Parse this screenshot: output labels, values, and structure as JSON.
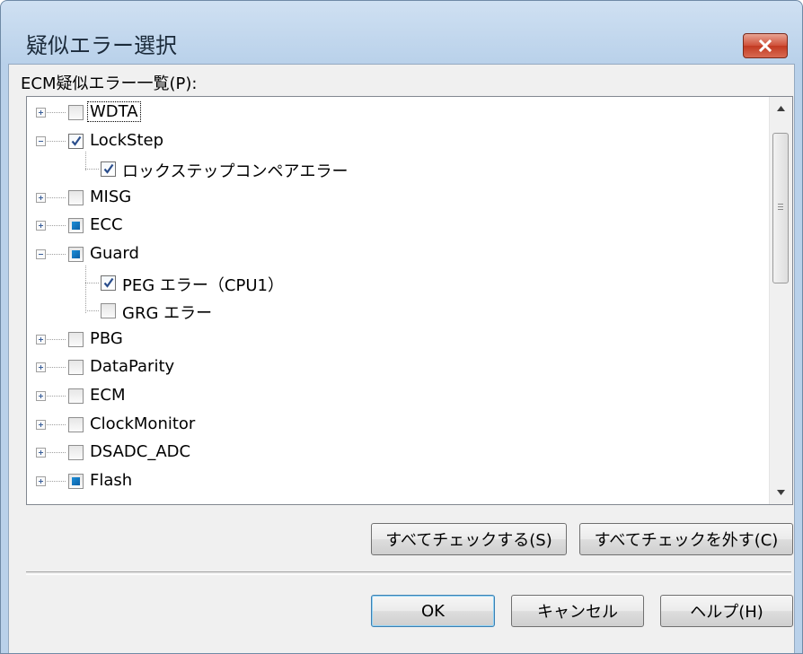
{
  "window": {
    "title": "疑似エラー選択"
  },
  "list": {
    "label": "ECM疑似エラー一覧(P):"
  },
  "tree": {
    "nodes": [
      {
        "label": "WDTA",
        "state": "unchecked",
        "expander": "plus",
        "level": 0,
        "focused": true
      },
      {
        "label": "LockStep",
        "state": "checked",
        "expander": "minus",
        "level": 0
      },
      {
        "label": "ロックステップコンペアエラー",
        "state": "checked",
        "expander": "none",
        "level": 1
      },
      {
        "label": "MISG",
        "state": "unchecked",
        "expander": "plus",
        "level": 0
      },
      {
        "label": "ECC",
        "state": "partial",
        "expander": "plus",
        "level": 0
      },
      {
        "label": "Guard",
        "state": "partial",
        "expander": "minus",
        "level": 0
      },
      {
        "label": "PEG エラー（CPU1）",
        "state": "checked",
        "expander": "none",
        "level": 1
      },
      {
        "label": "GRG エラー",
        "state": "unchecked",
        "expander": "none",
        "level": 1
      },
      {
        "label": "PBG",
        "state": "unchecked",
        "expander": "plus",
        "level": 0
      },
      {
        "label": "DataParity",
        "state": "unchecked",
        "expander": "plus",
        "level": 0
      },
      {
        "label": "ECM",
        "state": "unchecked",
        "expander": "plus",
        "level": 0
      },
      {
        "label": "ClockMonitor",
        "state": "unchecked",
        "expander": "plus",
        "level": 0
      },
      {
        "label": "DSADC_ADC",
        "state": "unchecked",
        "expander": "plus",
        "level": 0
      },
      {
        "label": "Flash",
        "state": "partial",
        "expander": "plus",
        "level": 0
      }
    ]
  },
  "buttons": {
    "check_all": "すべてチェックする(S)",
    "uncheck_all": "すべてチェックを外す(C)",
    "ok": "OK",
    "cancel": "キャンセル",
    "help": "ヘルプ(H)"
  },
  "colors": {
    "title_gradient_top": "#cfe0f2",
    "dialog_bg": "#f0f0f0",
    "partial_check": "#1d8fd8",
    "close_button": "#c23a22"
  },
  "icons": {
    "close": "close-icon",
    "expand": "plus-expander-icon",
    "collapse": "minus-expander-icon",
    "check": "checkmark-icon",
    "scroll_up": "scroll-up-arrow-icon",
    "scroll_down": "scroll-down-arrow-icon"
  }
}
